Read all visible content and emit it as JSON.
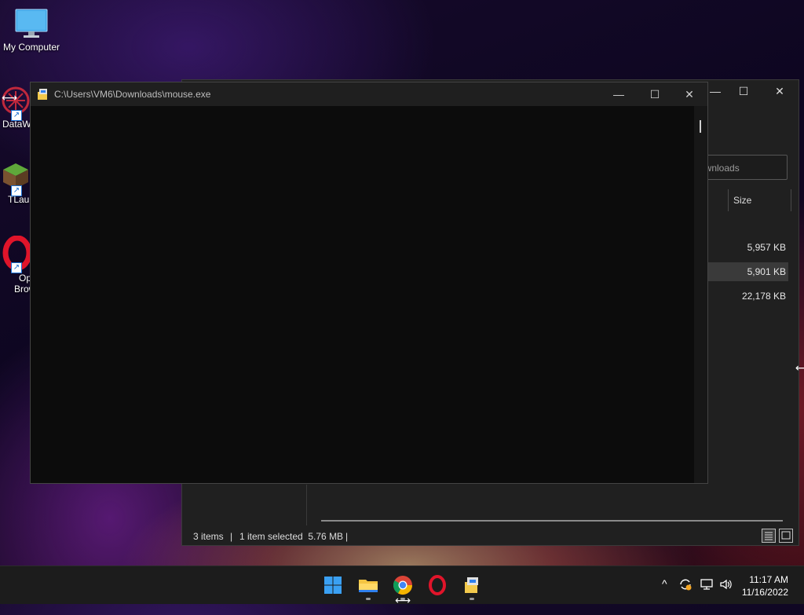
{
  "desktop": {
    "icons": [
      {
        "label": "My Computer"
      },
      {
        "label": "DataW"
      },
      {
        "label": "TLaun"
      },
      {
        "label_line1": "Op",
        "label_line2": "Brow"
      }
    ]
  },
  "explorer": {
    "search_placeholder": "ownloads",
    "column_size": "Size",
    "sizes": [
      "5,957 KB",
      "5,901 KB",
      "22,178 KB"
    ],
    "status_items": "3 items",
    "status_selected": "1 item selected  5.76 MB",
    "minimize": "—",
    "maximize": "☐",
    "close": "✕"
  },
  "console": {
    "title": "C:\\Users\\VM6\\Downloads\\mouse.exe",
    "minimize": "—",
    "maximize": "☐",
    "close": "✕"
  },
  "taskbar": {
    "apps": [
      "start-icon",
      "file-explorer-icon",
      "chrome-icon",
      "opera-icon",
      "console-app-icon"
    ],
    "time": "11:17 AM",
    "date": "11/16/2022",
    "chevron": "^"
  }
}
